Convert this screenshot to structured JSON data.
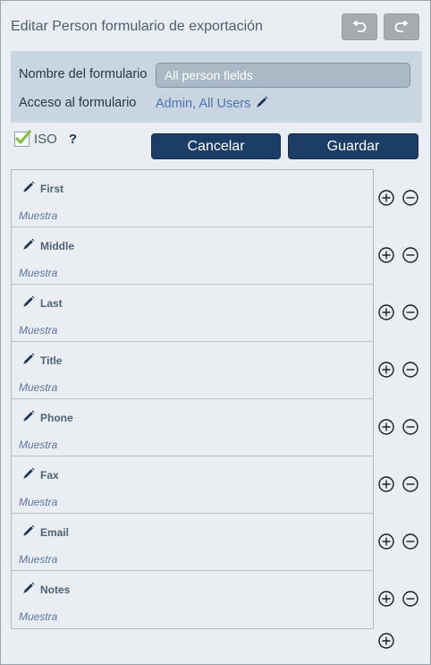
{
  "header": {
    "title": "Editar Person formulario de exportación",
    "undo_icon": "undo-icon",
    "redo_icon": "redo-icon"
  },
  "form": {
    "name_label": "Nombre del formulario",
    "name_value": "All person fields",
    "access_label": "Acceso al formulario",
    "access_value": "Admin, All Users",
    "access_icon": "pencil-icon"
  },
  "options": {
    "iso_label": "ISO",
    "iso_checked": true,
    "help_label": "?"
  },
  "buttons": {
    "cancel_label": "Cancelar",
    "save_label": "Guardar"
  },
  "fields": [
    {
      "name": "First",
      "sample": "Muestra"
    },
    {
      "name": "Middle",
      "sample": "Muestra"
    },
    {
      "name": "Last",
      "sample": "Muestra"
    },
    {
      "name": "Title",
      "sample": "Muestra"
    },
    {
      "name": "Phone",
      "sample": "Muestra"
    },
    {
      "name": "Fax",
      "sample": "Muestra"
    },
    {
      "name": "Email",
      "sample": "Muestra"
    },
    {
      "name": "Notes",
      "sample": "Muestra"
    }
  ],
  "colors": {
    "primary_button": "#1c3d66",
    "panel_bg": "#eaeef2",
    "form_box_bg": "#c9d6e1",
    "link": "#4d72b4",
    "check": "#7cc13a"
  }
}
